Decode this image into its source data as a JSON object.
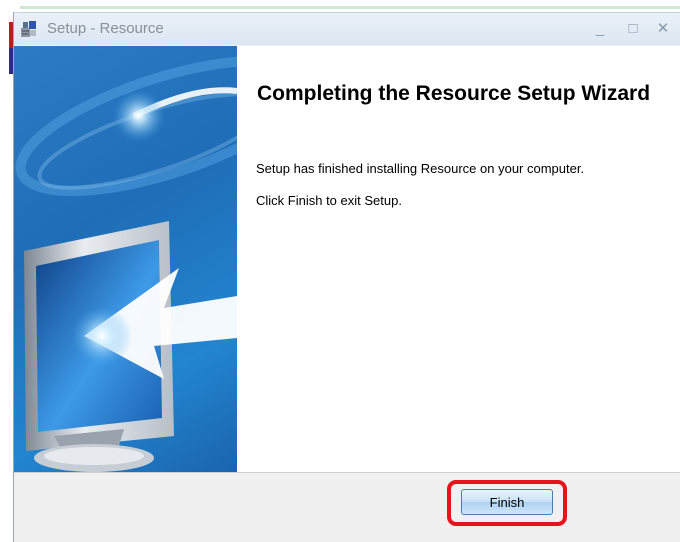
{
  "window": {
    "title": "Setup - Resource",
    "controls": {
      "minimize": "_",
      "maximize": "□",
      "close": "✕"
    }
  },
  "wizard": {
    "heading": "Completing the Resource Setup Wizard",
    "message": "Setup has finished installing Resource on your computer.",
    "instruction": "Click Finish to exit Setup."
  },
  "buttons": {
    "finish_label": "Finish"
  },
  "icons": {
    "app": "setup-app-icon",
    "sidebar_art": "computer-monitor-icon"
  },
  "colors": {
    "sidebar": "#1f6db7",
    "highlight": "#e5131b",
    "button_border": "#4a7bb8"
  }
}
